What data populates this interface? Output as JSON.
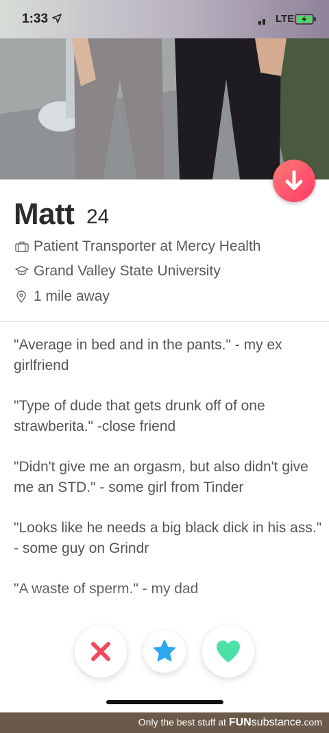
{
  "status_bar": {
    "time": "1:33",
    "network": "LTE",
    "location_icon": "location-arrow-icon",
    "signal_icon": "signal-bars-icon",
    "battery_icon": "battery-charging-icon"
  },
  "profile": {
    "name": "Matt",
    "age": "24",
    "job": "Patient Transporter at Mercy Health",
    "school": "Grand Valley State University",
    "distance": "1 mile away",
    "job_icon": "briefcase-icon",
    "school_icon": "graduation-cap-icon",
    "distance_icon": "location-pin-icon"
  },
  "bio": [
    "\"Average in bed and in the pants.\" - my ex girlfriend",
    "\"Type of dude that gets drunk off of one strawberita.\" -close friend",
    "\"Didn't give me an orgasm, but also didn't give me an STD.\" - some girl from Tinder",
    "\"Looks like he needs a big black dick in his ass.\"\n- some guy on Grindr",
    "\"A waste of sperm.\" - my dad"
  ],
  "actions": {
    "nope_icon": "close-x-icon",
    "super_like_icon": "star-icon",
    "like_icon": "heart-icon",
    "collapse_icon": "arrow-down-icon"
  },
  "colors": {
    "nope": "#f0495c",
    "super_like": "#2fa6f0",
    "like": "#4fe0a8",
    "collapse_bg": "#fd4d6a"
  },
  "footer": {
    "prefix": "Only the best stuff at",
    "brand_a": "FUN",
    "brand_b": "substance",
    "suffix": ".com"
  }
}
